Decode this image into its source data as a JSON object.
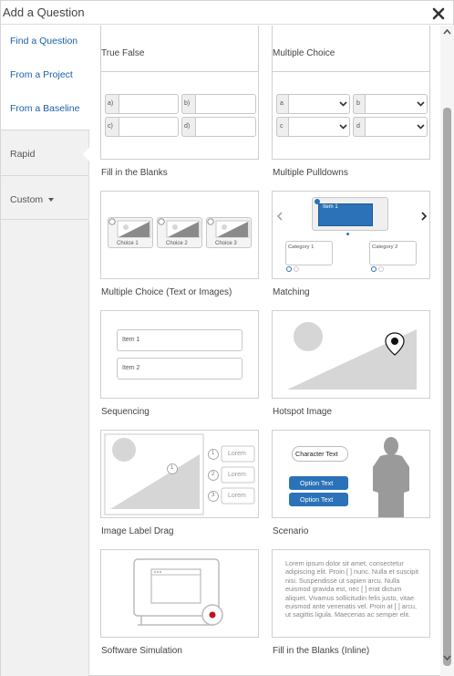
{
  "dialog": {
    "title": "Add a Question"
  },
  "sidebar": {
    "links": [
      "Find a Question",
      "From a Project",
      "From a Baseline"
    ],
    "rapid": "Rapid",
    "custom": "Custom"
  },
  "question_types": [
    "True False",
    "Multiple Choice",
    "Fill in the Blanks",
    "Multiple Pulldowns",
    "Multiple Choice (Text or Images)",
    "Matching",
    "Sequencing",
    "Hotspot Image",
    "Image Label Drag",
    "Scenario",
    "Software Simulation",
    "Fill in the Blanks (Inline)"
  ],
  "thumbnails": {
    "fill_blanks": [
      "a)",
      "b)",
      "c)",
      "d)"
    ],
    "pulldowns": [
      "a",
      "b",
      "c",
      "d"
    ],
    "mc_images": [
      "Choice 1",
      "Choice 2",
      "Choice 3"
    ],
    "matching": {
      "item": "Item 1",
      "categories": [
        "Category 1",
        "Category 2"
      ]
    },
    "sequencing": [
      "Item 1",
      "Item 2"
    ],
    "label_drag": {
      "marker": "1",
      "numbers": [
        "1",
        "2",
        "3"
      ],
      "labels": [
        "Lorem",
        "Lorem",
        "Lorem"
      ]
    },
    "scenario": {
      "bubble": "Character Text",
      "options": [
        "Option Text",
        "Option Text"
      ]
    },
    "inline_text": "Lorem ipsum dolor sit amet, consectetur adipiscing elit. Proin [ ] nunc. Nulla et suscipit nisi. Suspendisse ut sapien arcu. Nulla euismod gravida est, nec [ ] erat dictum aliquet. Vivamus sollicitudin felis justo, vitae euismod ante venenatis vel. Proin at [ ] arcu, ut sagittis ligula. Maecenas ac semper elit."
  },
  "colors": {
    "link": "#1d5fa8",
    "accent_blue": "#2b72b8",
    "selected_bg": "#ffffff",
    "sidebar_bg": "#f1f1f1"
  }
}
